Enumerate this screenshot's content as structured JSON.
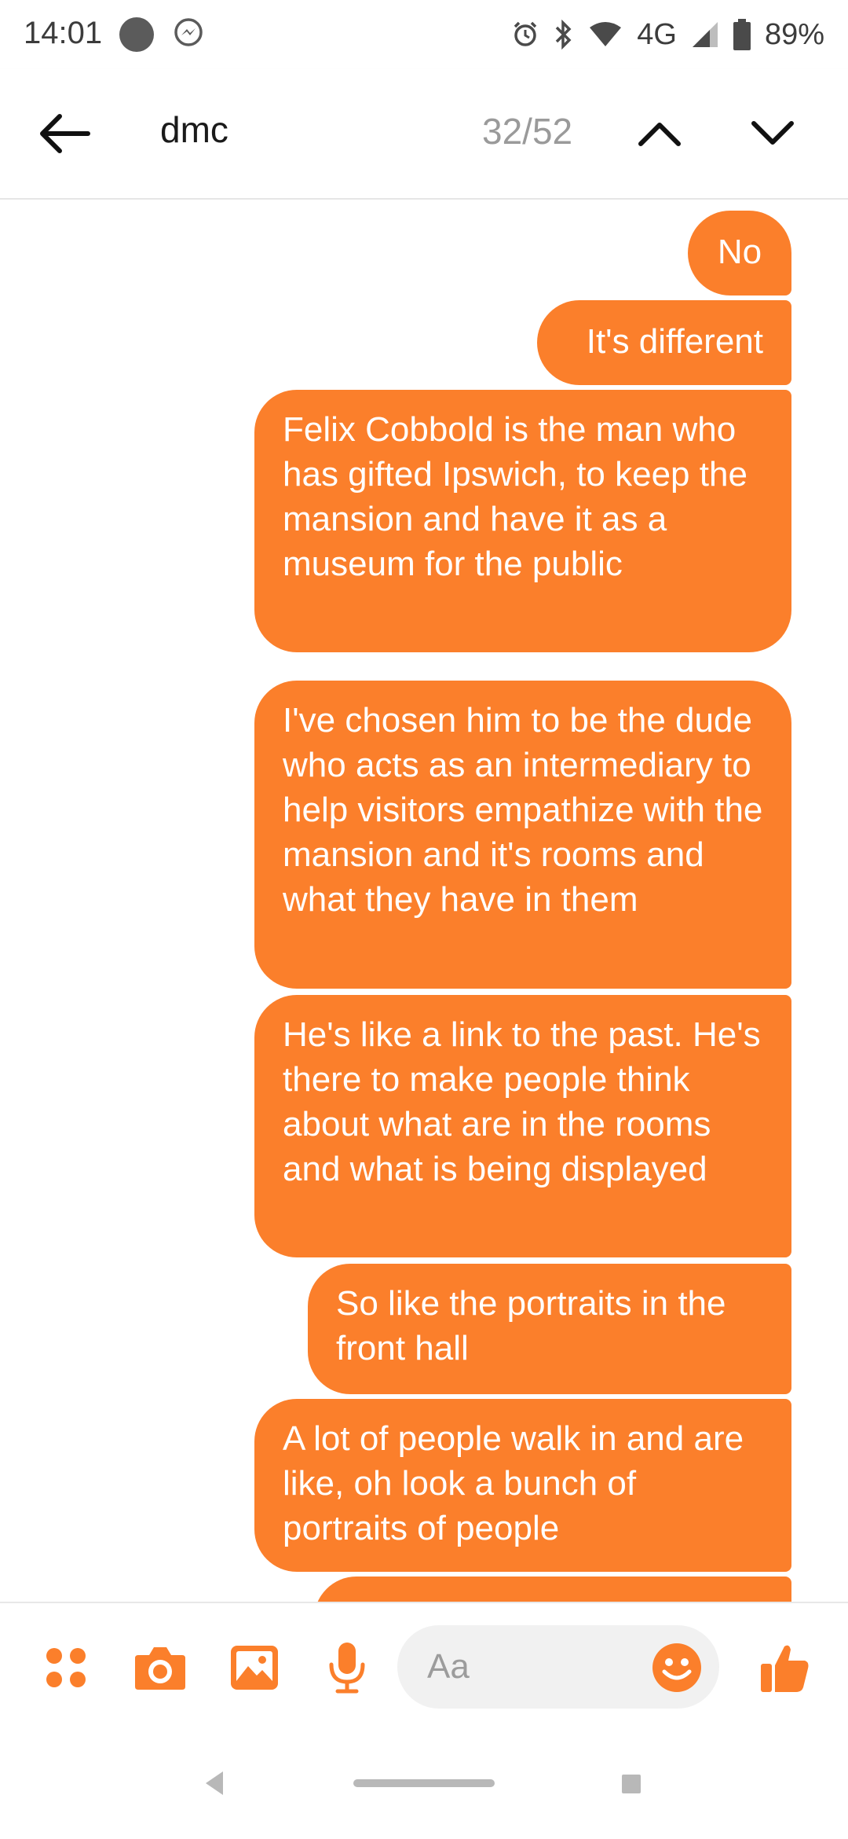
{
  "status_bar": {
    "time": "14:01",
    "network": "4G",
    "battery": "89%"
  },
  "header": {
    "search_term": "dmc",
    "match_counter": "32/52"
  },
  "messages": [
    {
      "text": "No"
    },
    {
      "text": "It's different"
    },
    {
      "text": "Felix Cobbold is the man who has gifted Ipswich, to keep the mansion and have it as a museum for the public"
    },
    {
      "text": "I've chosen him to be the dude who acts as an intermediary to help visitors empathize with the mansion and it's rooms and what they have in them"
    },
    {
      "text": "He's like a link to the past. He's there to make people think about what are in the rooms and what is being displayed"
    },
    {
      "text": "So like the portraits in the front hall"
    },
    {
      "text": "A lot of people walk in and are like, oh look a bunch of portraits of people"
    }
  ],
  "composer": {
    "placeholder": "Aa"
  },
  "colors": {
    "accent": "#fb7f2b",
    "bubble_text": "#ffffff"
  },
  "icons": {
    "composer": [
      "more-dots-icon",
      "camera-icon",
      "gallery-icon",
      "microphone-icon",
      "emoji-icon",
      "thumbs-up-icon"
    ],
    "status": [
      "messenger-icon",
      "alarm-icon",
      "bluetooth-icon",
      "wifi-icon",
      "signal-icon",
      "battery-icon"
    ]
  }
}
